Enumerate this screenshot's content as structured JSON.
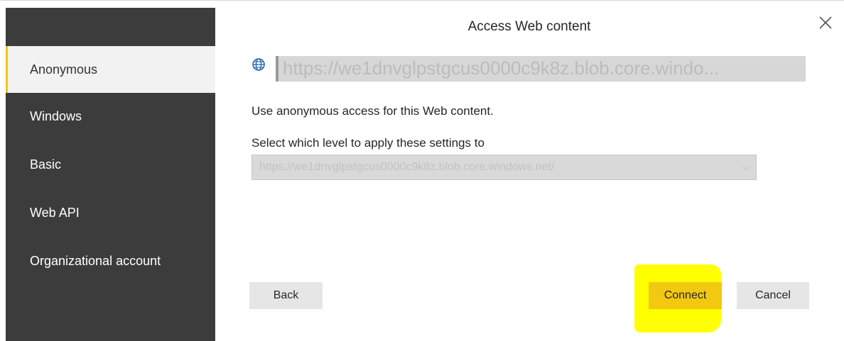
{
  "dialog": {
    "title": "Access Web content"
  },
  "sidebar": {
    "items": [
      {
        "label": "Anonymous",
        "selected": true
      },
      {
        "label": "Windows",
        "selected": false
      },
      {
        "label": "Basic",
        "selected": false
      },
      {
        "label": "Web API",
        "selected": false
      },
      {
        "label": "Organizational account",
        "selected": false
      }
    ]
  },
  "content": {
    "url": "https://we1dnvglpstgcus0000c9k8z.blob.core.windo...",
    "description": "Use anonymous access for this Web content.",
    "level_label": "Select which level to apply these settings to",
    "level_selected": "https://we1dnvglpstgcus0000c9k8z.blob.core.windows.net/"
  },
  "buttons": {
    "back": "Back",
    "connect": "Connect",
    "cancel": "Cancel"
  },
  "icons": {
    "globe": "globe-icon",
    "close": "close-icon",
    "chevron": "chevron-down-icon"
  },
  "colors": {
    "sidebar_bg": "#3c3c3c",
    "accent": "#f2c811",
    "highlight": "#ffff00"
  }
}
